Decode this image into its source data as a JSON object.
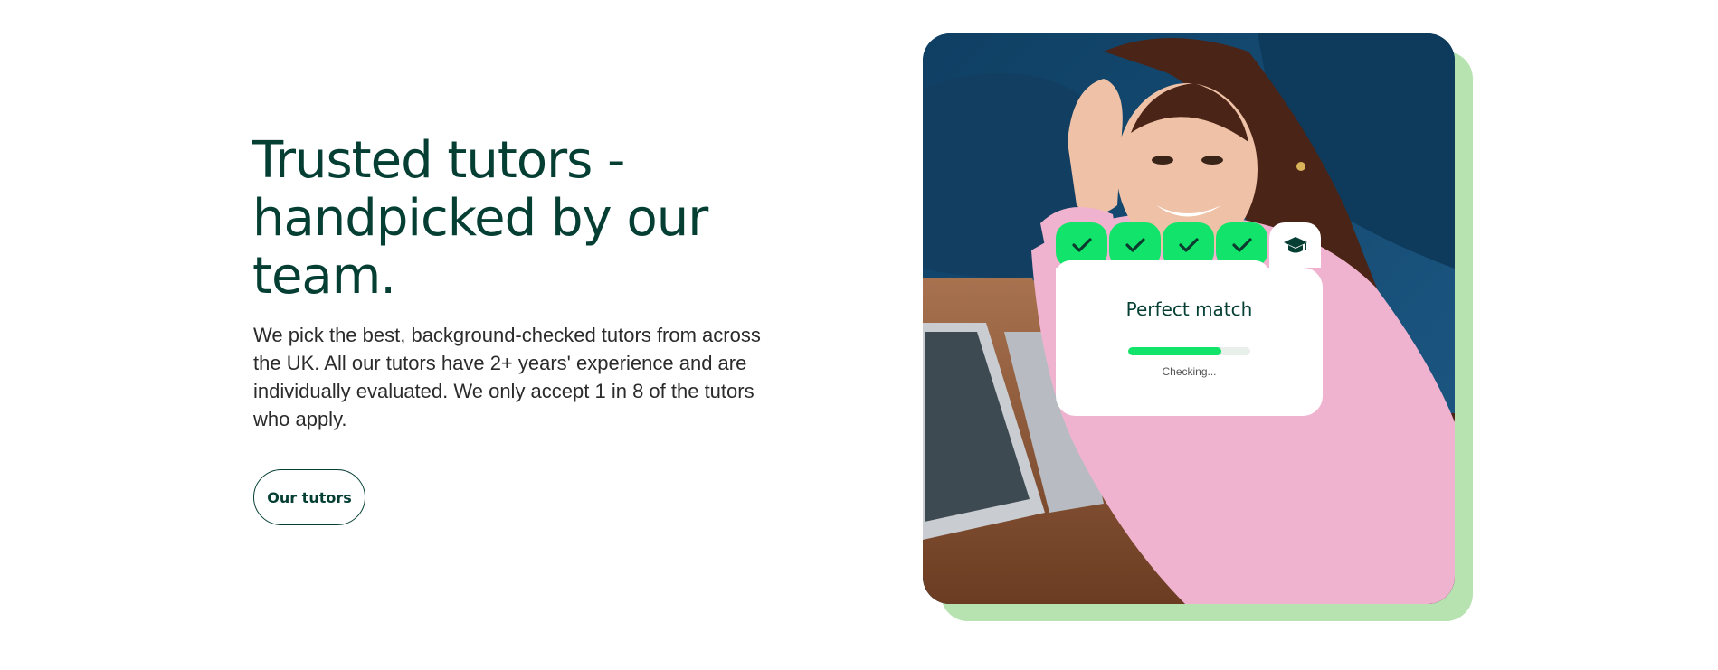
{
  "hero": {
    "headline_lines": [
      "Trusted tutors -",
      "handpicked by our",
      "team."
    ],
    "description": "We pick the best, background-checked tutors from across the UK. All our tutors have 2+ years' experience and are individually evaluated. We only accept 1 in 8 of the tutors who apply.",
    "cta_label": "Our tutors"
  },
  "match_widget": {
    "badges": [
      "check-icon",
      "check-icon",
      "check-icon",
      "check-icon",
      "graduation-cap-icon"
    ],
    "title": "Perfect match",
    "progress": 0.76,
    "status": "Checking..."
  },
  "colors": {
    "brand_dark": "#053f34",
    "accent_green": "#12e36a",
    "shadow_green": "#b6e3b0"
  }
}
